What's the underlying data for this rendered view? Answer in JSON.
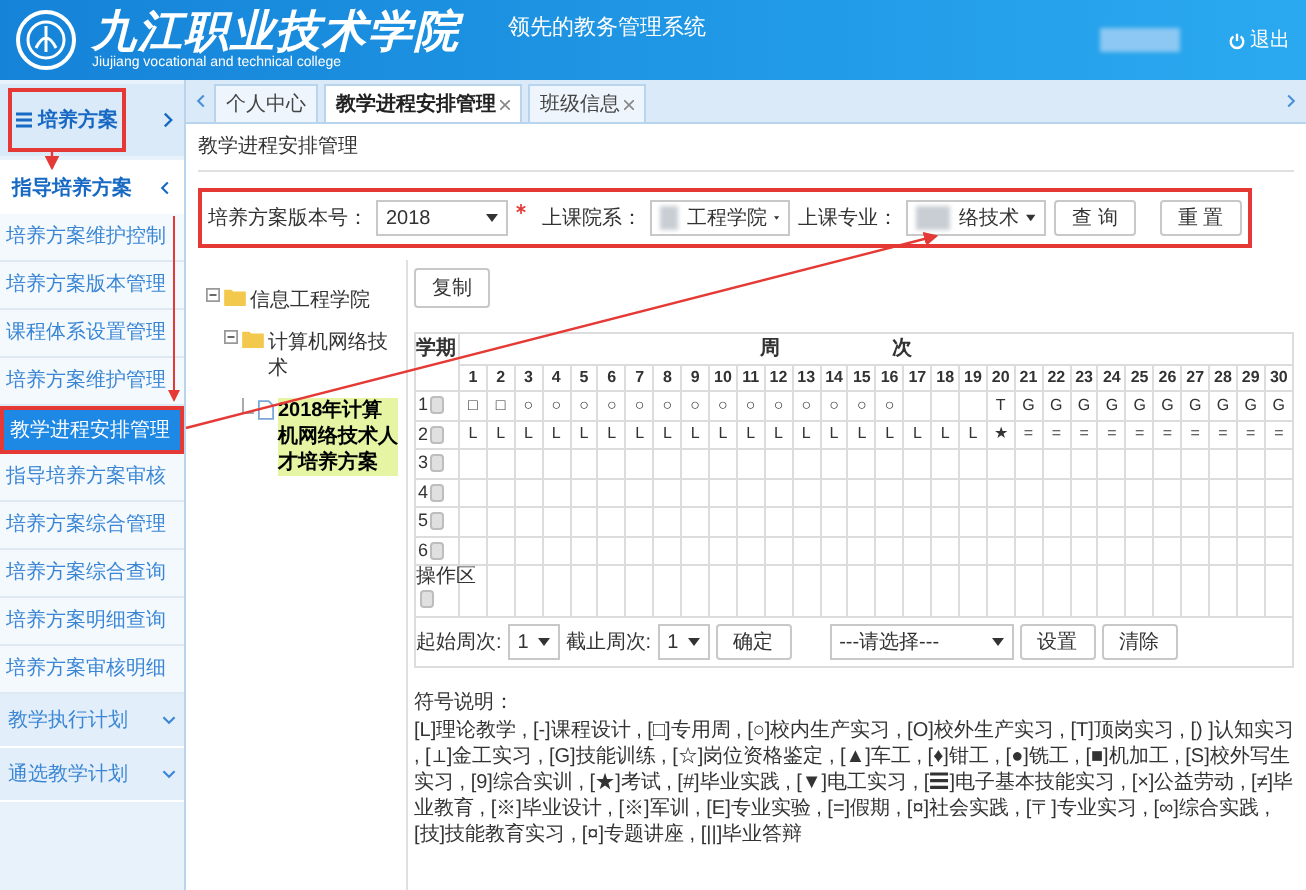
{
  "header": {
    "school_name": "九江职业技术学院",
    "school_name_en": "Jiujiang vocational and technical college",
    "system_name": "领先的教务管理系统",
    "logout": "退出"
  },
  "sidebar": {
    "module": "培养方案",
    "groups": [
      {
        "label": "指导培养方案",
        "expanded": true,
        "items": [
          {
            "label": "培养方案维护控制",
            "selected": false
          },
          {
            "label": "培养方案版本管理",
            "selected": false
          },
          {
            "label": "课程体系设置管理",
            "selected": false
          },
          {
            "label": "培养方案维护管理",
            "selected": false
          },
          {
            "label": "教学进程安排管理",
            "selected": true
          },
          {
            "label": "指导培养方案审核",
            "selected": false
          },
          {
            "label": "培养方案综合管理",
            "selected": false
          },
          {
            "label": "培养方案综合查询",
            "selected": false
          },
          {
            "label": "培养方案明细查询",
            "selected": false
          },
          {
            "label": "培养方案审核明细",
            "selected": false
          }
        ]
      },
      {
        "label": "教学执行计划",
        "expanded": false
      },
      {
        "label": "通选教学计划",
        "expanded": false
      }
    ]
  },
  "tabs": [
    {
      "label": "个人中心",
      "selected": false,
      "closable": false
    },
    {
      "label": "教学进程安排管理",
      "selected": true,
      "closable": true
    },
    {
      "label": "班级信息",
      "selected": false,
      "closable": true
    }
  ],
  "page_title": "教学进程安排管理",
  "filters": [
    {
      "label": "培养方案版本号：",
      "value": "2018",
      "required": true,
      "redacted": false
    },
    {
      "label": "上课院系：",
      "value": "工程学院",
      "required": false,
      "redacted": true
    },
    {
      "label": "上课专业：",
      "value": "络技术",
      "required": false,
      "redacted": true
    }
  ],
  "filter_buttons": [
    "查 询",
    "重 置"
  ],
  "tree": [
    {
      "label": "信息工程学院",
      "kind": "folder",
      "expanded": true,
      "selected": false,
      "children": [
        {
          "label": "计算机网络技术",
          "kind": "folder",
          "expanded": true,
          "selected": false,
          "children": [
            {
              "label": "2018年计算机网络技术人才培养方案",
              "kind": "file",
              "selected": true
            }
          ]
        }
      ]
    }
  ],
  "schedule": {
    "copy_button": "复制",
    "term_header": "学期",
    "week_header": [
      "周",
      "次"
    ],
    "weeks": [
      "1",
      "2",
      "3",
      "4",
      "5",
      "6",
      "7",
      "8",
      "9",
      "10",
      "11",
      "12",
      "13",
      "14",
      "15",
      "16",
      "17",
      "18",
      "19",
      "20",
      "21",
      "22",
      "23",
      "24",
      "25",
      "26",
      "27",
      "28",
      "29",
      "30"
    ],
    "rows": [
      {
        "term": "1",
        "checked": false,
        "cells": [
          "□",
          "□",
          "○",
          "○",
          "○",
          "○",
          "○",
          "○",
          "○",
          "○",
          "○",
          "○",
          "○",
          "○",
          "○",
          "○",
          null,
          null,
          null,
          "T",
          "G",
          "G",
          "G",
          "G",
          "G",
          "G",
          "G",
          "G",
          "G",
          "G"
        ]
      },
      {
        "term": "2",
        "checked": false,
        "cells": [
          "L",
          "L",
          "L",
          "L",
          "L",
          "L",
          "L",
          "L",
          "L",
          "L",
          "L",
          "L",
          "L",
          "L",
          "L",
          "L",
          "L",
          "L",
          "L",
          "★",
          "=",
          "=",
          "=",
          "=",
          "=",
          "=",
          "=",
          "=",
          "=",
          "="
        ]
      },
      {
        "term": "3",
        "checked": false
      },
      {
        "term": "4",
        "checked": false
      },
      {
        "term": "5",
        "checked": false
      },
      {
        "term": "6",
        "checked": false
      }
    ],
    "operation_label": "操作区",
    "operation_checked": false
  },
  "controls": {
    "start_label": "起始周次:",
    "start_value": "1",
    "end_label": "截止周次:",
    "end_value": "1",
    "confirm": "确定",
    "symbol_placeholder": "---请选择---",
    "set": "设置",
    "clear": "清除"
  },
  "legend": {
    "title": "符号说明：",
    "text": "[L]理论教学 , [-]课程设计 , [□]专用周 , [○]校内生产实习 , [O]校外生产实习 , [T]顶岗实习 , [) ]认知实习 , [⊥]金工实习 , [G]技能训练 , [☆]岗位资格鉴定 , [▲]车工 , [♦]钳工 , [●]铣工 , [■]机加工 , [S]校外写生实习 , [9]综合实训 , [★]考试 , [#]毕业实践 , [▼]电工实习 , [☰]电子基本技能实习 , [×]公益劳动 , [≠]毕业教育 , [※]毕业设计 , [※]军训 , [E]专业实验 , [=]假期 , [¤]社会实践 , [〒]专业实习 , [∞]综合实践 , [技]技能教育实习 , [¤]专题讲座 , [||]毕业答辩"
  }
}
